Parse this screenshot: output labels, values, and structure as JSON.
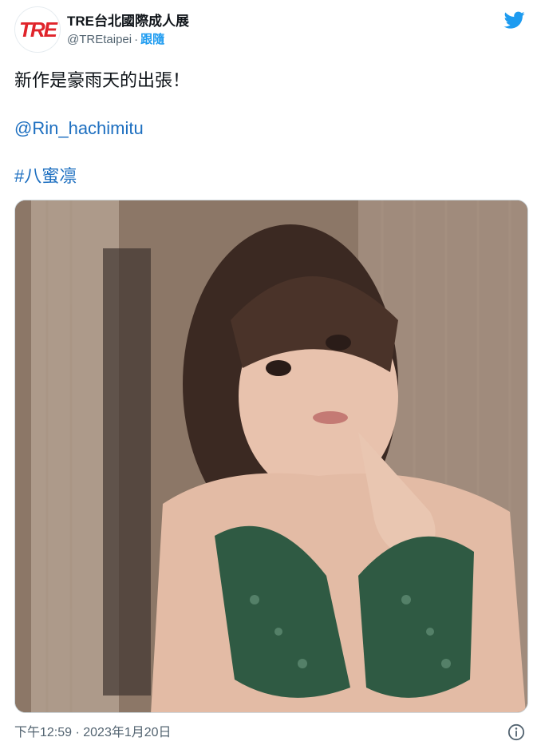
{
  "account": {
    "avatar_text": "TRE",
    "display_name": "TRE台北國際成人展",
    "handle": "@TREtaipei",
    "separator": "·",
    "follow_label": "跟隨"
  },
  "tweet": {
    "text_line1": "新作是豪雨天的出張！",
    "mention": "@Rin_hachimitu",
    "hashtag": "#八蜜凛"
  },
  "footer": {
    "timestamp": "下午12:59 · 2023年1月20日"
  },
  "icons": {
    "brand": "twitter-bird-icon",
    "info": "info-circle-icon"
  },
  "colors": {
    "link": "#1d6fc0",
    "twitter_blue": "#1d9bf0",
    "brand_red": "#e0242b"
  }
}
